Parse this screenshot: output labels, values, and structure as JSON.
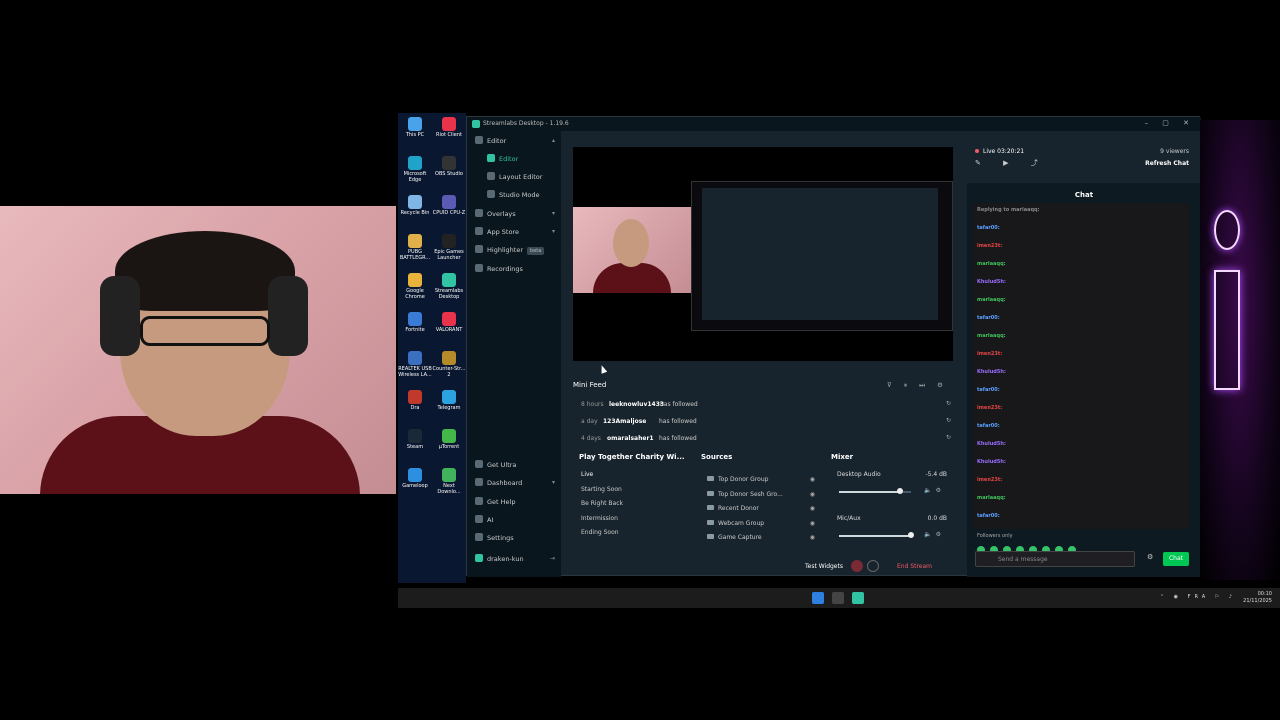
{
  "desktop_icons": [
    {
      "label": "This PC",
      "color": "#4aa3e8"
    },
    {
      "label": "Riot Client",
      "color": "#e8334a"
    },
    {
      "label": "Microsoft Edge",
      "color": "#1fa3c9"
    },
    {
      "label": "OBS Studio",
      "color": "#333333"
    },
    {
      "label": "Recycle Bin",
      "color": "#7fb6e6"
    },
    {
      "label": "CPUID CPU-Z",
      "color": "#5b5bb6"
    },
    {
      "label": "PUBG BATTLEGR...",
      "color": "#e0b04a"
    },
    {
      "label": "Epic Games Launcher",
      "color": "#222222"
    },
    {
      "label": "Google Chrome",
      "color": "#e9b23c"
    },
    {
      "label": "Streamlabs Desktop",
      "color": "#31c3a2"
    },
    {
      "label": "Fortnite",
      "color": "#3a7bd5"
    },
    {
      "label": "VALORANT",
      "color": "#e8334a"
    },
    {
      "label": "REALTEK USB Wireless LA...",
      "color": "#3b6fbf"
    },
    {
      "label": "Counter-Str... 2",
      "color": "#b58b2a"
    },
    {
      "label": "Dra",
      "color": "#c0392b"
    },
    {
      "label": "Telegram",
      "color": "#2aa3e0"
    },
    {
      "label": "Steam",
      "color": "#1b2838"
    },
    {
      "label": "µTorrent",
      "color": "#45b649"
    },
    {
      "label": "Gameloop",
      "color": "#2c8fe0"
    },
    {
      "label": "Next Downlo...",
      "color": "#41b35c"
    }
  ],
  "window": {
    "title": "Streamlabs Desktop - 1.19.6"
  },
  "sidebar": {
    "editor": "Editor",
    "editor_sub": "Editor",
    "layout_editor": "Layout Editor",
    "studio_mode": "Studio Mode",
    "overlays": "Overlays",
    "app_store": "App Store",
    "highlighter": "Highlighter",
    "highlighter_badge": "beta",
    "recordings": "Recordings",
    "get_ultra": "Get Ultra",
    "dashboard": "Dashboard",
    "get_help": "Get Help",
    "ai": "AI",
    "settings": "Settings",
    "user": "draken-kun"
  },
  "mini_feed": {
    "title": "Mini Feed",
    "items": [
      {
        "time": "8 hours",
        "user": "leeknowluv1433",
        "action": "has followed"
      },
      {
        "time": "a day",
        "user": "123Amaljose",
        "action": "has followed"
      },
      {
        "time": "4 days",
        "user": "omaralsaher1",
        "action": "has followed"
      }
    ]
  },
  "scenes": {
    "title": "Play Together Charity Wi...",
    "items": [
      "Live",
      "Starting Soon",
      "Be Right Back",
      "Intermission",
      "Ending Soon"
    ]
  },
  "sources": {
    "title": "Sources",
    "items": [
      "Top Donor Group",
      "Top Donor Sesh Gro...",
      "Recent Donor",
      "Webcam Group",
      "Game Capture"
    ]
  },
  "mixer": {
    "title": "Mixer",
    "channels": [
      {
        "name": "Desktop Audio",
        "db": "-5.4 dB",
        "level": 0.85
      },
      {
        "name": "Mic/Aux",
        "db": "0.0 dB",
        "level": 1.0
      }
    ]
  },
  "footer": {
    "test_widgets": "Test Widgets",
    "end_stream": "End Stream"
  },
  "chat": {
    "live_time": "Live 03:20:21",
    "viewers": "9 viewers",
    "refresh": "Refresh Chat",
    "title": "Chat",
    "messages": [
      {
        "user": "Replying to marlaaqq:",
        "text": "",
        "color": "#888888"
      },
      {
        "user": "tafar00:",
        "text": "",
        "color": "#5aa0ff"
      },
      {
        "user": "imen23t:",
        "text": "",
        "color": "#e84545"
      },
      {
        "user": "marlaaqq:",
        "text": "",
        "color": "#3ec45a"
      },
      {
        "user": "Khulud5h:",
        "text": "",
        "color": "#9b6cff"
      },
      {
        "user": "marlaaqq:",
        "text": "",
        "color": "#3ec45a"
      },
      {
        "user": "tafar00:",
        "text": "",
        "color": "#5aa0ff"
      },
      {
        "user": "marlaaqq:",
        "text": "",
        "color": "#3ec45a"
      },
      {
        "user": "imen23t:",
        "text": "",
        "color": "#e84545"
      },
      {
        "user": "Khulud5h:",
        "text": "",
        "color": "#9b6cff"
      },
      {
        "user": "tafar00:",
        "text": "",
        "color": "#5aa0ff"
      },
      {
        "user": "imen23t:",
        "text": "",
        "color": "#e84545"
      },
      {
        "user": "tafar00:",
        "text": "",
        "color": "#5aa0ff"
      },
      {
        "user": "Khulud5h:",
        "text": "",
        "color": "#9b6cff"
      },
      {
        "user": "Khulud5h:",
        "text": "",
        "color": "#9b6cff"
      },
      {
        "user": "imen23t:",
        "text": "",
        "color": "#e84545"
      },
      {
        "user": "marlaaqq:",
        "text": "",
        "color": "#3ec45a"
      },
      {
        "user": "tafar00:",
        "text": "",
        "color": "#5aa0ff"
      }
    ],
    "followers_only": "Followers only",
    "placeholder": "Send a message",
    "send": "Chat"
  },
  "taskbar": {
    "lang": "FRA",
    "time": "00:10",
    "date": "21/11/2025"
  }
}
